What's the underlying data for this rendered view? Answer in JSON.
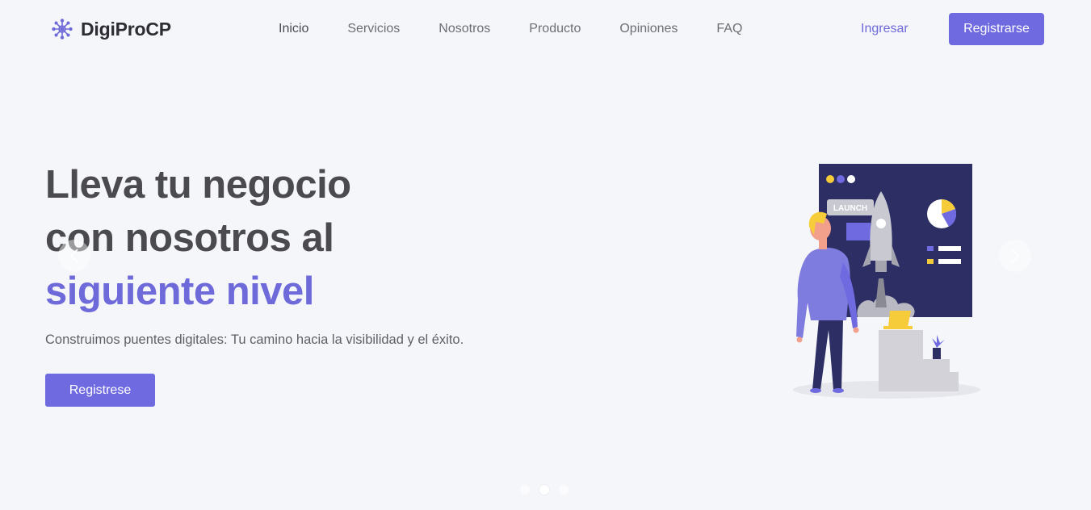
{
  "brand": {
    "name": "DigiProCP",
    "icon": "network-logo-icon"
  },
  "nav": {
    "links": [
      {
        "label": "Inicio",
        "active": true
      },
      {
        "label": "Servicios",
        "active": false
      },
      {
        "label": "Nosotros",
        "active": false
      },
      {
        "label": "Producto",
        "active": false
      },
      {
        "label": "Opiniones",
        "active": false
      },
      {
        "label": "FAQ",
        "active": false
      }
    ],
    "login_label": "Ingresar",
    "register_label": "Registrarse"
  },
  "hero": {
    "title_line1": "Lleva tu negocio",
    "title_line2": "con nosotros al",
    "title_accent": "siguiente nivel",
    "subtitle": "Construimos puentes digitales: Tu camino hacia la visibilidad y el éxito.",
    "cta_label": "Registrese",
    "illustration_text": "LAUNCH"
  },
  "carousel": {
    "prev_icon": "chevron-left-icon",
    "next_icon": "chevron-right-icon",
    "slide_count": 3,
    "active_slide": 2
  },
  "colors": {
    "accent": "#6f6ae0",
    "heading": "#4a4a4f",
    "background": "#f5f6fa",
    "board": "#2d2e63",
    "yellow": "#f6cc3a"
  }
}
